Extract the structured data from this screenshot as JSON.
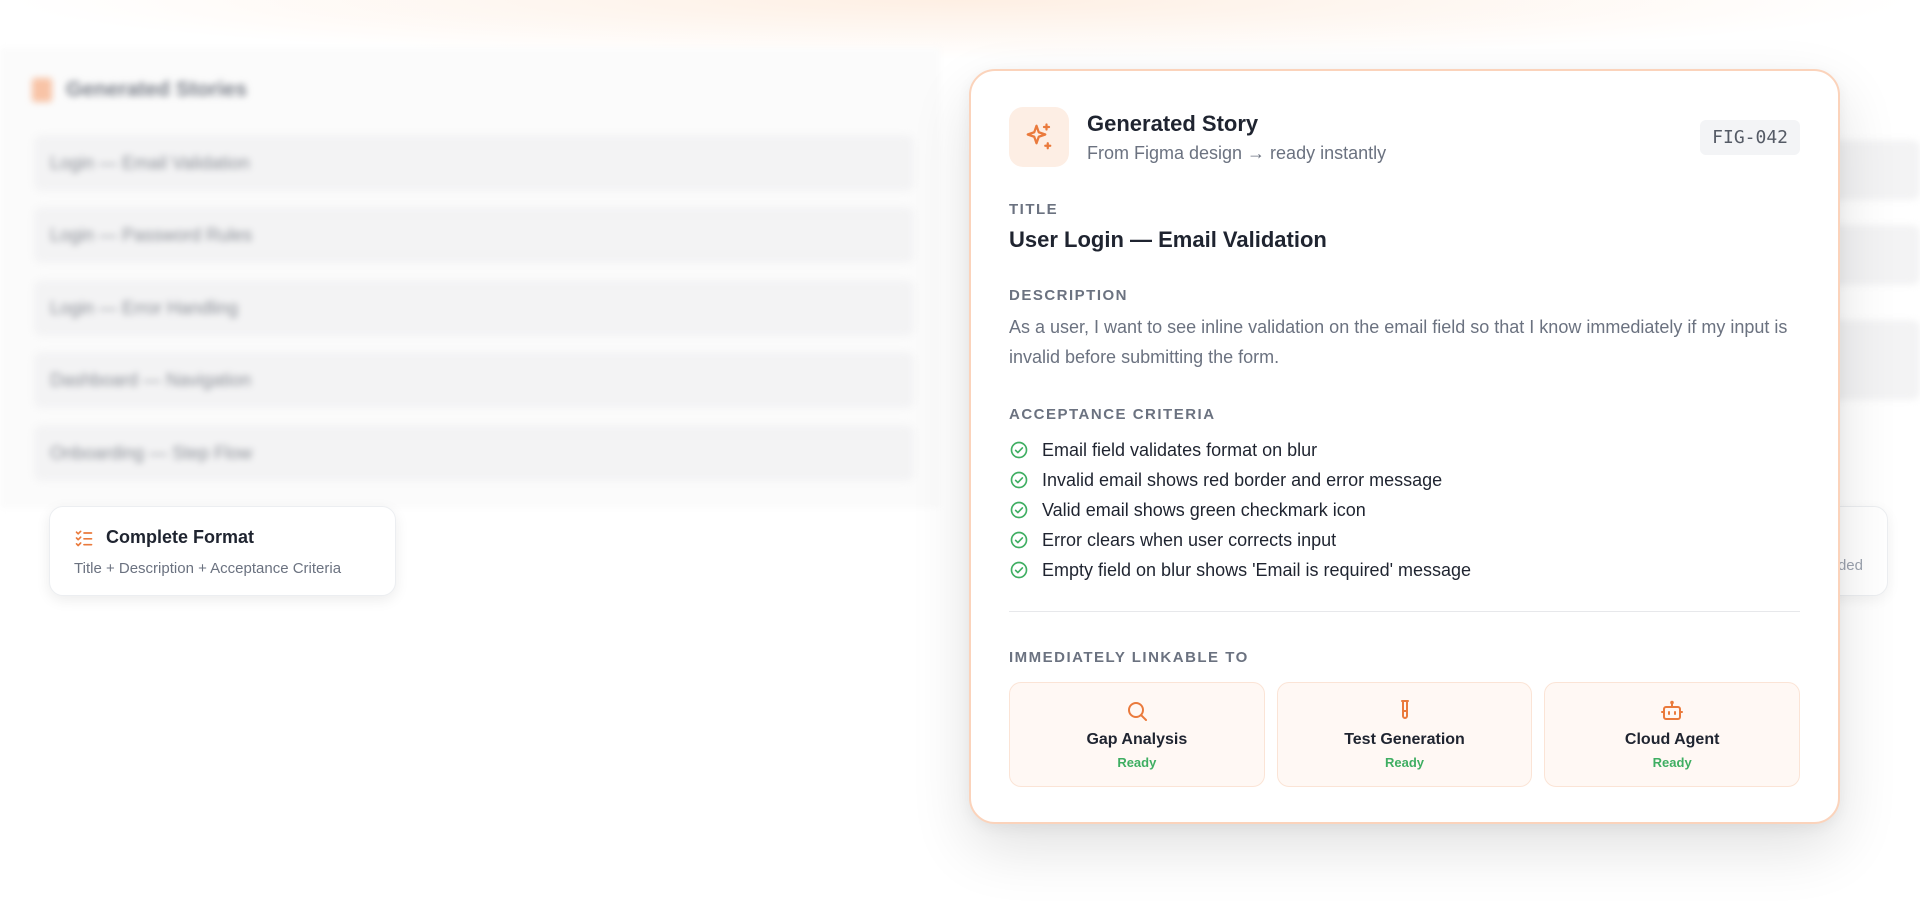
{
  "background": {
    "header_title": "Generated Stories",
    "items": [
      "Login — Email Validation",
      "Login — Password Rules",
      "Login — Error Handling",
      "Dashboard — Navigation",
      "Onboarding — Step Flow"
    ]
  },
  "format_card": {
    "icon": "list-check-icon",
    "title": "Complete Format",
    "subtitle": "Title + Description + Acceptance Criteria"
  },
  "side_chip": {
    "partial_text": "ded"
  },
  "story": {
    "icon": "sparkles-icon",
    "header_title": "Generated Story",
    "header_subtitle": "From Figma design → ready instantly",
    "id_badge": "FIG-042",
    "title_label": "TITLE",
    "title": "User Login — Email Validation",
    "description_label": "DESCRIPTION",
    "description": "As a user, I want to see inline validation on the email field so that I know immediately if my input is invalid before submitting the form.",
    "criteria_label": "ACCEPTANCE CRITERIA",
    "criteria": [
      "Email field validates format on blur",
      "Invalid email shows red border and error message",
      "Valid email shows green checkmark icon",
      "Error clears when user corrects input",
      "Empty field on blur shows 'Email is required' message"
    ],
    "linkable_label": "IMMEDIATELY LINKABLE TO",
    "links": [
      {
        "name": "Gap Analysis",
        "status": "Ready",
        "icon": "search-icon"
      },
      {
        "name": "Test Generation",
        "status": "Ready",
        "icon": "test-tube-icon"
      },
      {
        "name": "Cloud Agent",
        "status": "Ready",
        "icon": "robot-icon"
      }
    ]
  },
  "colors": {
    "accent": "#ea7a3c",
    "accent_soft": "#fdeee4",
    "success": "#3fae62",
    "border": "#fbd3bb"
  }
}
